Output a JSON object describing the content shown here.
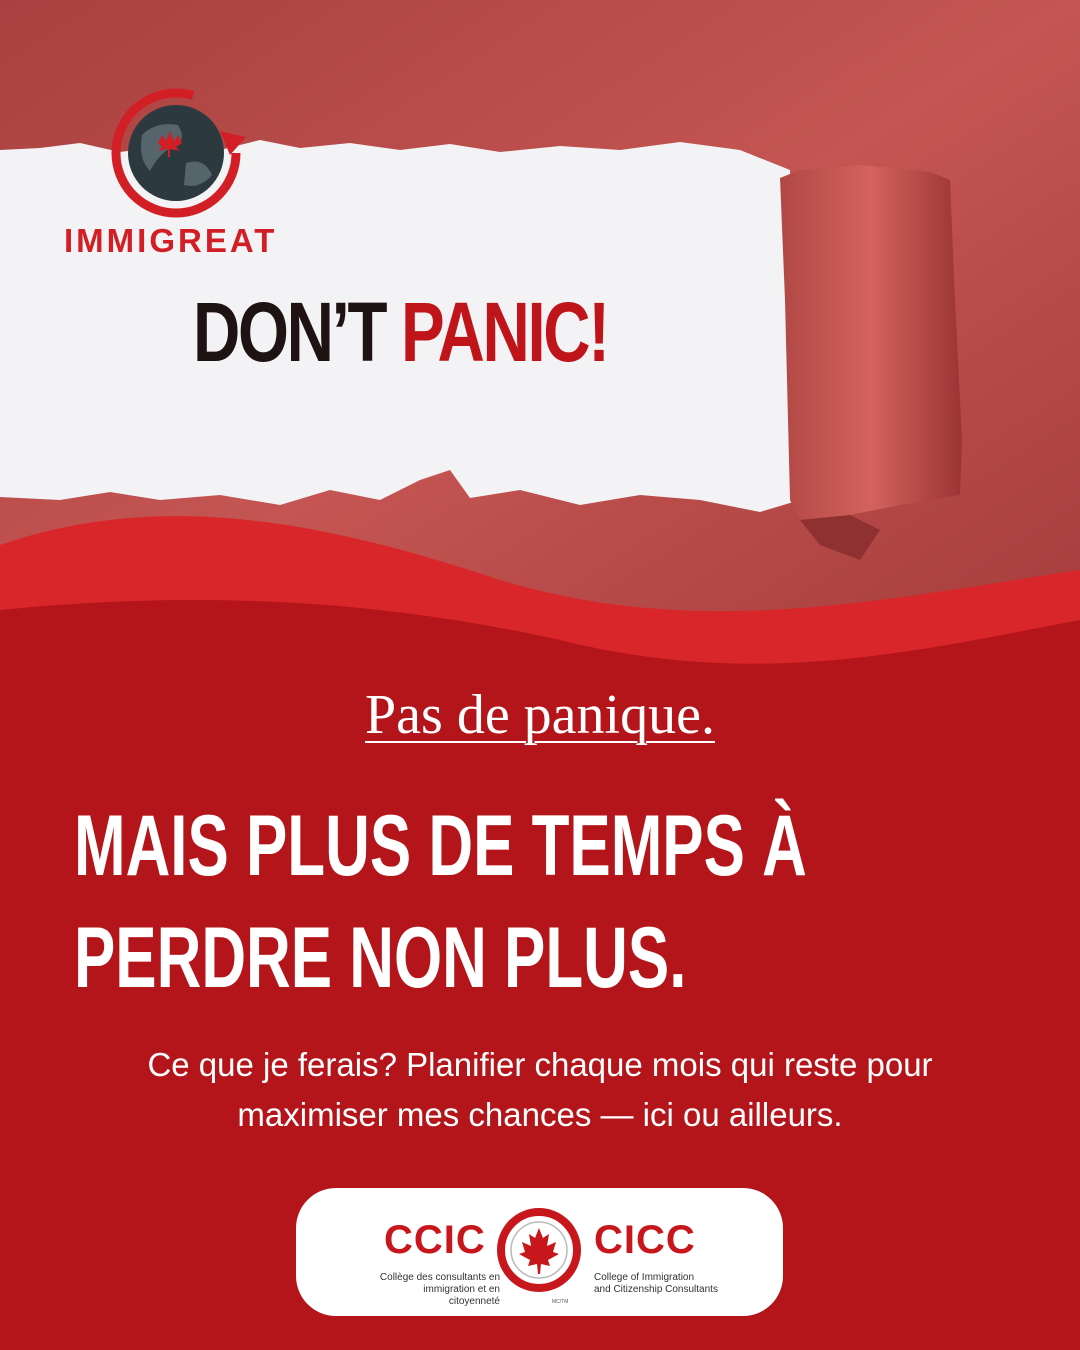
{
  "brand": {
    "name": "IMMIGREAT",
    "accent_color": "#d21f26",
    "icons": [
      "globe-icon",
      "maple-leaf-icon",
      "orbit-arrow-icon"
    ]
  },
  "headline": {
    "part1": "DON’T",
    "part2": "PANIC!"
  },
  "subtitle": "Pas de panique.",
  "main_message": {
    "line1": "MAIS PLUS DE TEMPS À",
    "line2": "PERDRE NON PLUS."
  },
  "body": {
    "line1": "Ce que je ferais? Planifier chaque mois qui reste pour",
    "line2": "maximiser mes chances — ici ou ailleurs."
  },
  "badge": {
    "left_code": "CCIC",
    "left_text_line1": "Collège des consultants en",
    "left_text_line2": "immigration et en citoyenneté",
    "right_code": "CICC",
    "right_text_line1": "College of Immigration",
    "right_text_line2": "and Citizenship Consultants",
    "mark": "MC/TM"
  },
  "colors": {
    "background_red": "#b3151a",
    "paper": "#c4524f",
    "wave": "#d9262b"
  }
}
